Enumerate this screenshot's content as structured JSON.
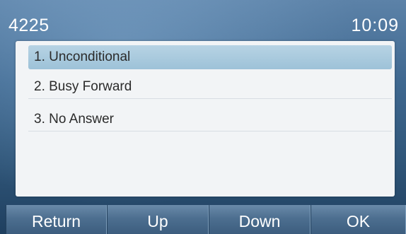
{
  "status_bar": {
    "extension": "4225",
    "time": "10:09"
  },
  "menu": {
    "items": [
      {
        "label": "1. Unconditional",
        "selected": true
      },
      {
        "label": "2. Busy Forward",
        "selected": false
      },
      {
        "label": "3. No Answer",
        "selected": false
      }
    ]
  },
  "softkeys": [
    {
      "label": "Return"
    },
    {
      "label": "Up"
    },
    {
      "label": "Down"
    },
    {
      "label": "OK"
    }
  ],
  "colors": {
    "selection": "#a9cadd",
    "panel": "#f2f4f6",
    "softkey": "#4d6f90"
  }
}
